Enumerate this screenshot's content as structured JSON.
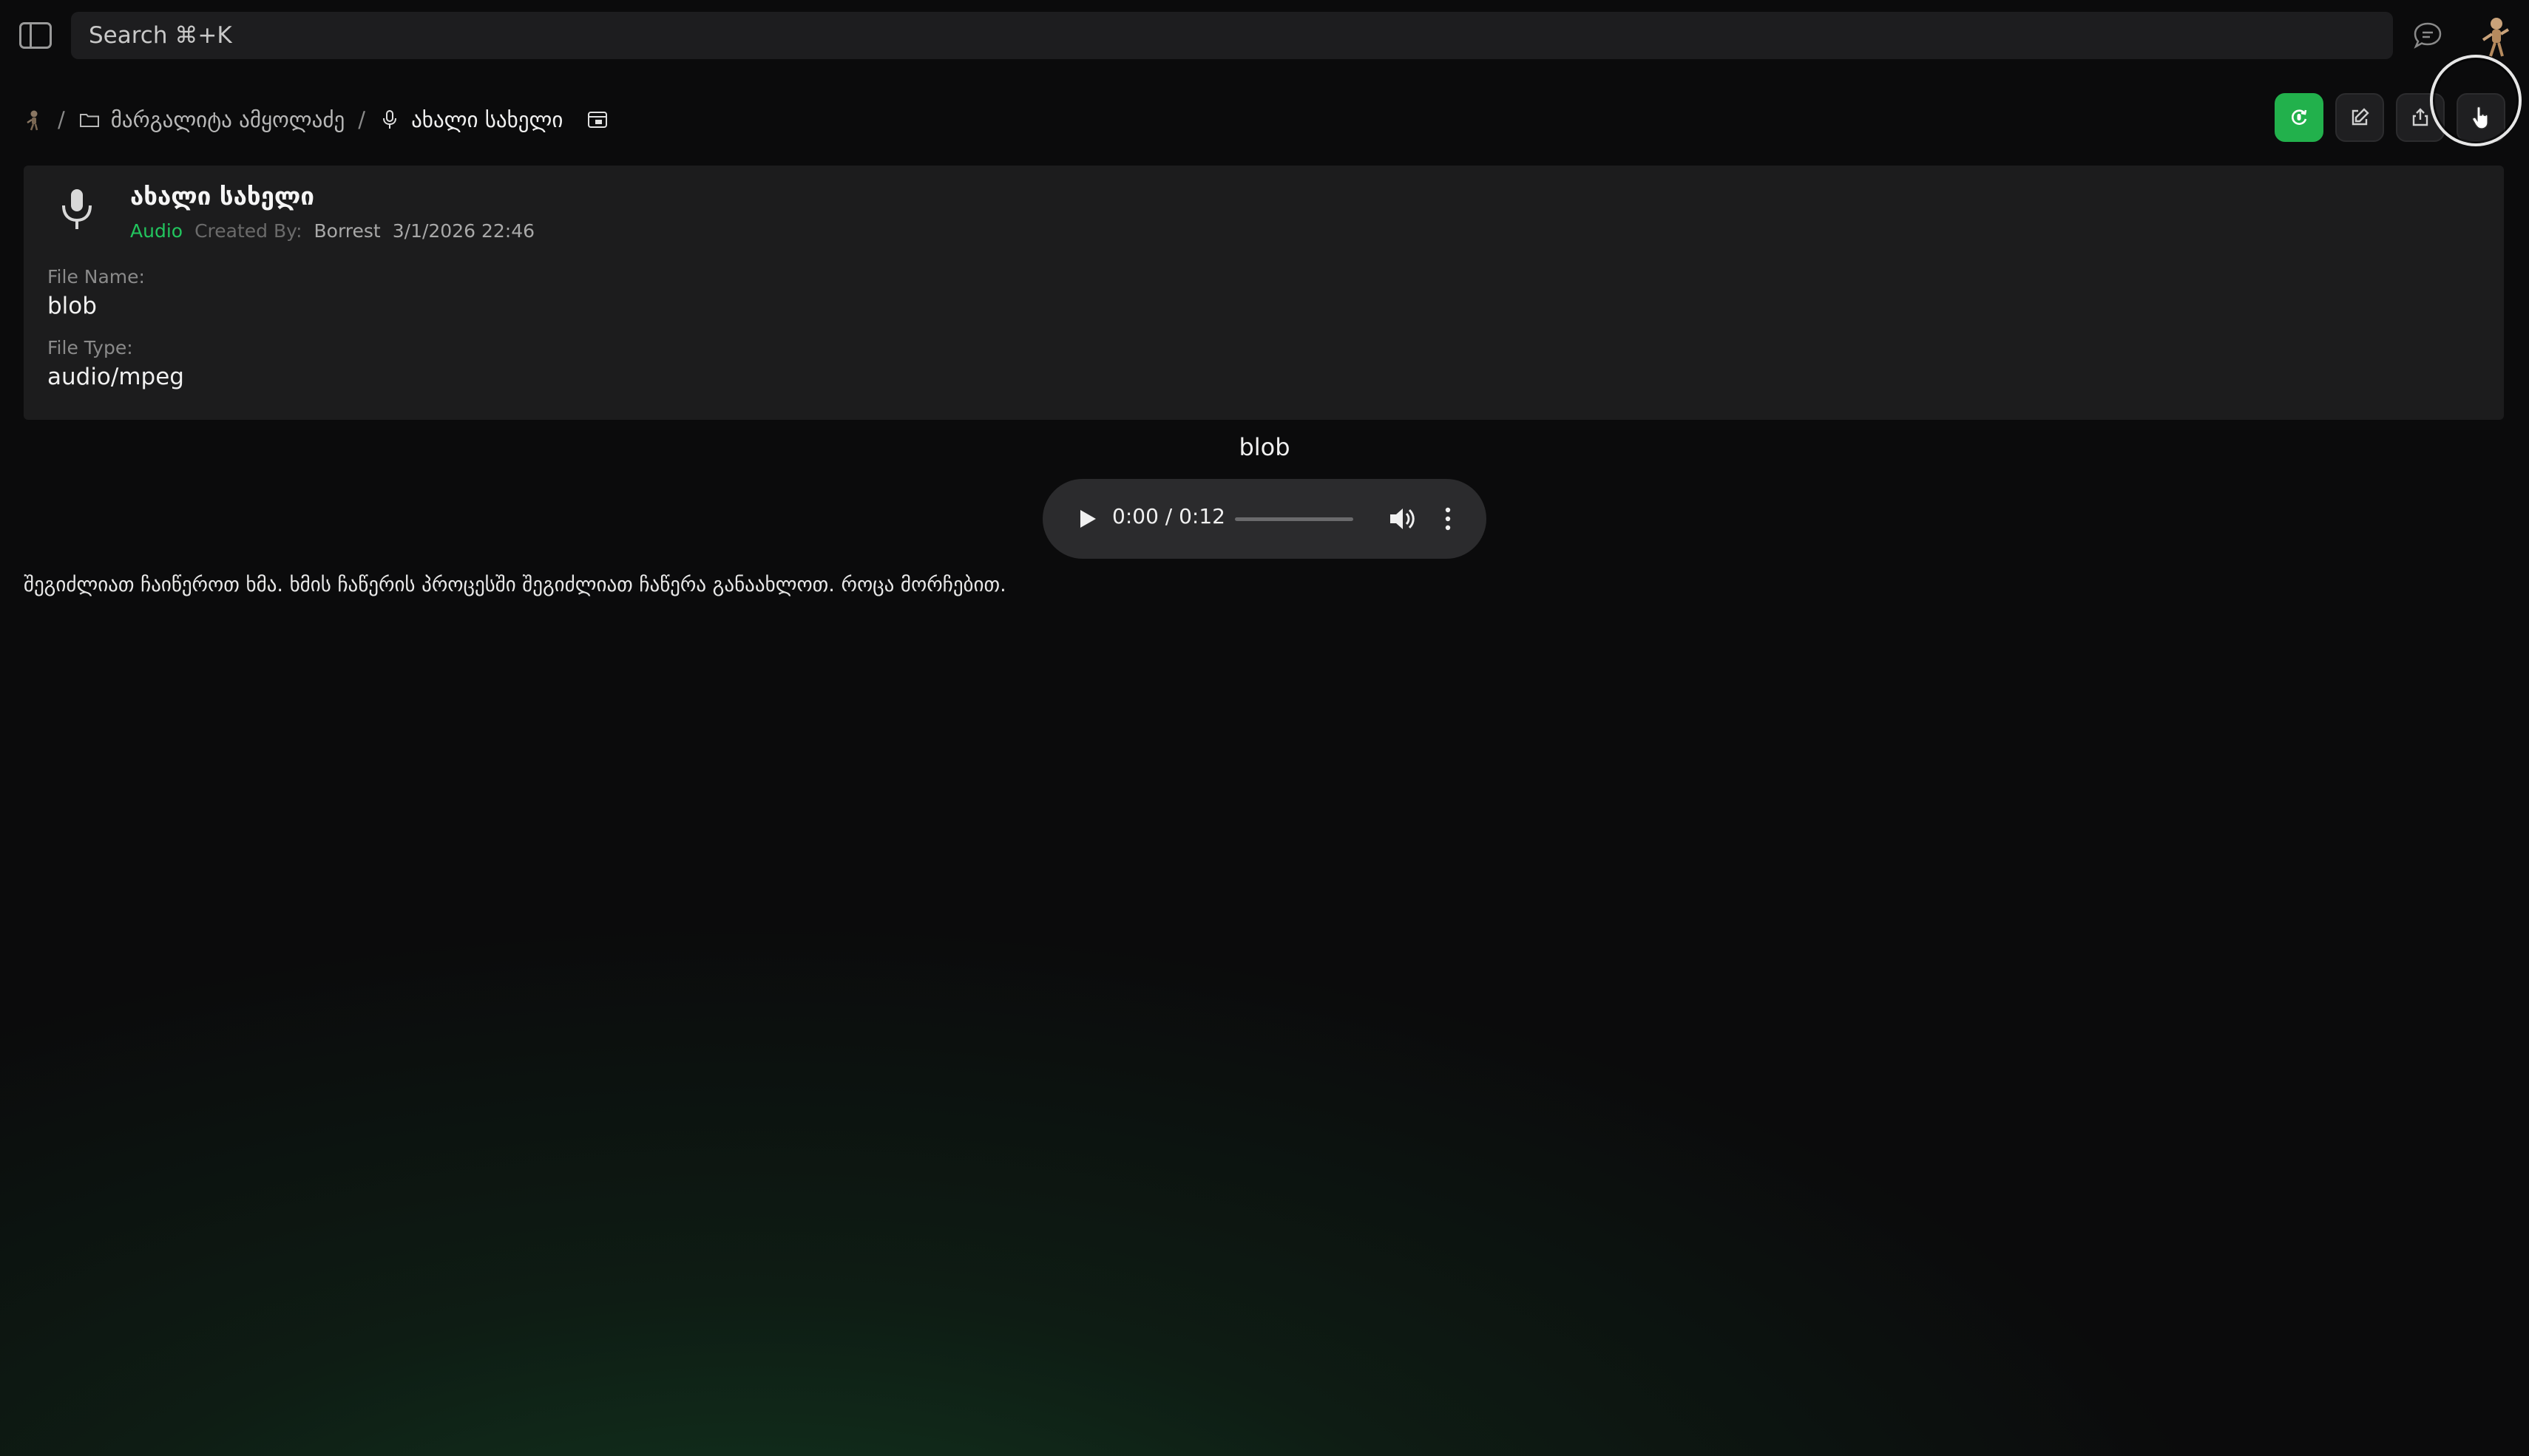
{
  "search": {
    "placeholder": "Search ⌘+K"
  },
  "breadcrumb": {
    "folder": "მარგალიტა ამყოლაძე",
    "current": "ახალი სახელი"
  },
  "item": {
    "title": "ახალი სახელი",
    "type": "Audio",
    "created_by_label": "Created By:",
    "author": "Borrest",
    "date": "3/1/2026 22:46",
    "file_name_label": "File Name:",
    "file_name": "blob",
    "file_type_label": "File Type:",
    "file_type": "audio/mpeg"
  },
  "player": {
    "title": "blob",
    "time": "0:00 / 0:12",
    "progress": 0
  },
  "description": "შეგიძლიათ ჩაიწეროთ ხმა. ხმის ჩაწერის პროცესში შეგიძლიათ ჩაწერა განაახლოთ. როცა მორჩებით.",
  "colors": {
    "accent_green": "#22b14c",
    "type_green": "#22c55e",
    "background": "#0b0b0c"
  },
  "icons": {
    "sidebar": "sidebar-toggle-icon",
    "chat": "chat-bubble-icon",
    "actions": [
      "record-icon",
      "edit-icon",
      "share-icon",
      "pointer-icon"
    ]
  }
}
